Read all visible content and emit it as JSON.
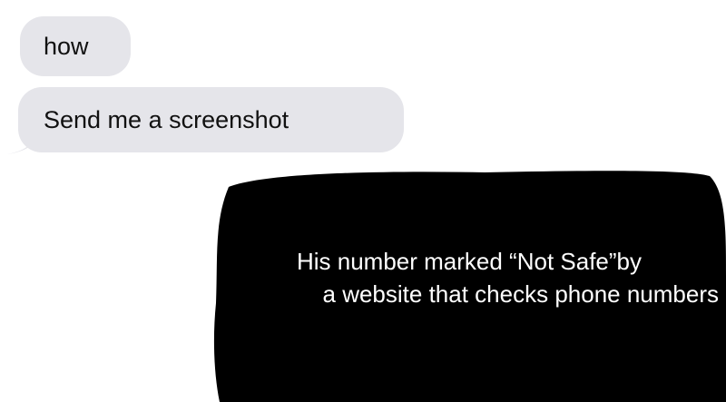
{
  "messages": [
    {
      "direction": "incoming",
      "text": "how"
    },
    {
      "direction": "incoming",
      "text": "Send me a screenshot"
    }
  ],
  "redaction": {
    "color": "#000000",
    "caption_line_1": "His number marked “Not Safe”by",
    "caption_line_2": "a website that checks phone numbers"
  },
  "colors": {
    "incoming_bubble": "#e5e5ea",
    "incoming_text": "#111111",
    "background": "#ffffff"
  }
}
